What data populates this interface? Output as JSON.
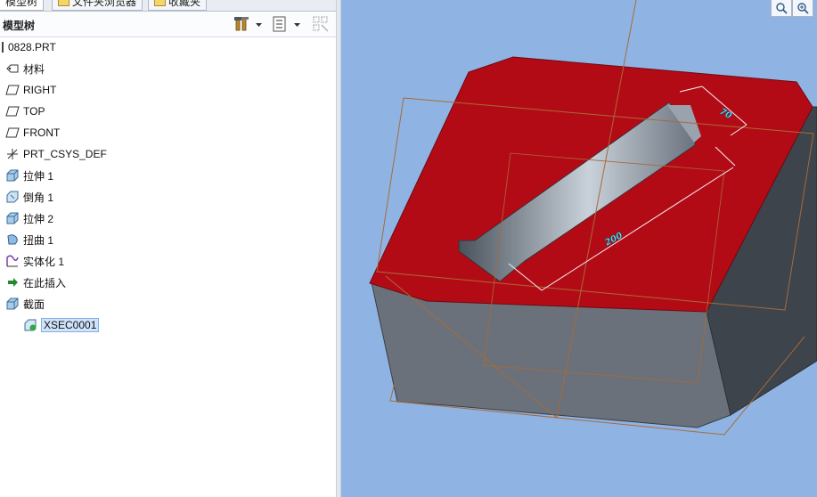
{
  "tabs": [
    {
      "label": "模型树",
      "active": true
    },
    {
      "label": "文件夹浏览器",
      "active": false
    },
    {
      "label": "收藏夹",
      "active": false
    }
  ],
  "toolbar": {
    "title": "模型树",
    "icons": [
      "tools-icon",
      "dropdown-icon",
      "tree-settings-icon",
      "dropdown-icon",
      "filter-icon"
    ]
  },
  "tree": {
    "items": [
      {
        "label": "0828.PRT",
        "icon": "part-icon"
      },
      {
        "label": "材料",
        "icon": "material-icon"
      },
      {
        "label": "RIGHT",
        "icon": "datum-plane-icon"
      },
      {
        "label": "TOP",
        "icon": "datum-plane-icon"
      },
      {
        "label": "FRONT",
        "icon": "datum-plane-icon"
      },
      {
        "label": "PRT_CSYS_DEF",
        "icon": "csys-icon"
      },
      {
        "label": "拉伸 1",
        "icon": "extrude-icon"
      },
      {
        "label": "倒角 1",
        "icon": "chamfer-icon"
      },
      {
        "label": "拉伸 2",
        "icon": "extrude-icon"
      },
      {
        "label": "扭曲 1",
        "icon": "warp-icon"
      },
      {
        "label": "实体化 1",
        "icon": "solidify-icon"
      },
      {
        "label": "在此插入",
        "icon": "insert-arrow-icon"
      },
      {
        "label": "截面",
        "icon": "section-icon"
      },
      {
        "label": "XSEC0001",
        "icon": "xsec-icon",
        "selected": true
      }
    ]
  },
  "viewport": {
    "dimensions": [
      {
        "label": "70"
      },
      {
        "label": "200"
      }
    ],
    "colors": {
      "background": "#8fb4e3",
      "top_face": "#b30b16",
      "side_face": "#5c6470"
    }
  }
}
